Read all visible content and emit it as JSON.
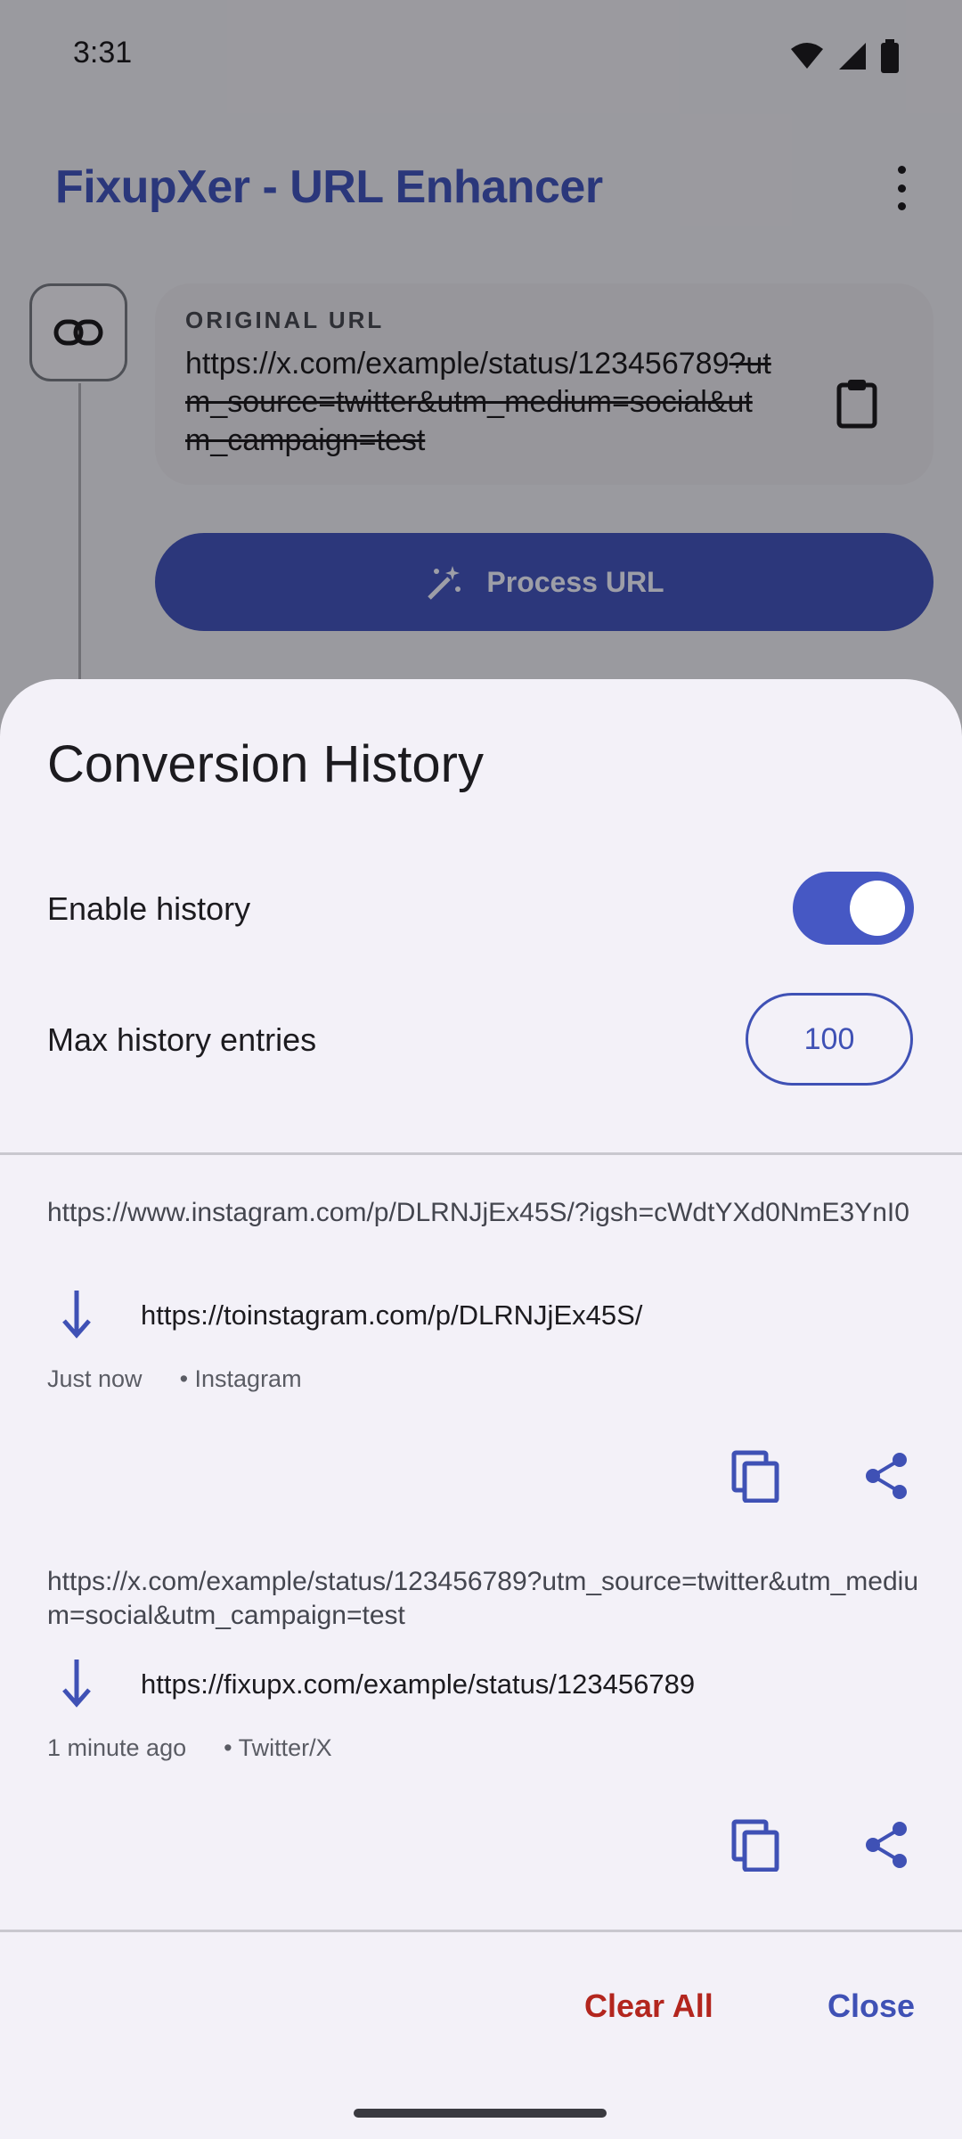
{
  "status_bar": {
    "time": "3:31",
    "icons": [
      "wifi-icon",
      "signal-icon",
      "battery-icon"
    ]
  },
  "app_bar": {
    "title": "FixupXer - URL Enhancer",
    "menu_icon": "more-vert-icon"
  },
  "input_card": {
    "label": "ORIGINAL URL",
    "url_kept": "https://x.com/example/status/123456789",
    "url_stripped": "?utm_source=twitter&utm_medium=social&utm_campaign=test",
    "paste_icon": "clipboard-icon"
  },
  "process_button": {
    "label": "Process URL",
    "icon": "magic-wand-icon"
  },
  "history_sheet": {
    "title": "Conversion History",
    "enable_label": "Enable history",
    "enabled": true,
    "max_label": "Max history entries",
    "max_value": "100",
    "entries": [
      {
        "original": "https://www.instagram.com/p/DLRNJjEx45S/?igsh=cWdtYXd0NmE3YnI0",
        "converted": "https://toinstagram.com/p/DLRNJjEx45S/",
        "time": "Just now",
        "platform": "• Instagram"
      },
      {
        "original": "https://x.com/example/status/123456789?utm_source=twitter&utm_medium=social&utm_campaign=test",
        "converted": "https://fixupx.com/example/status/123456789",
        "time": "1 minute ago",
        "platform": "• Twitter/X"
      }
    ],
    "clear_all_label": "Clear All",
    "close_label": "Close"
  },
  "colors": {
    "accent": "#3f51b5",
    "danger": "#b3261e",
    "sheet_bg": "#f3f1f8"
  }
}
